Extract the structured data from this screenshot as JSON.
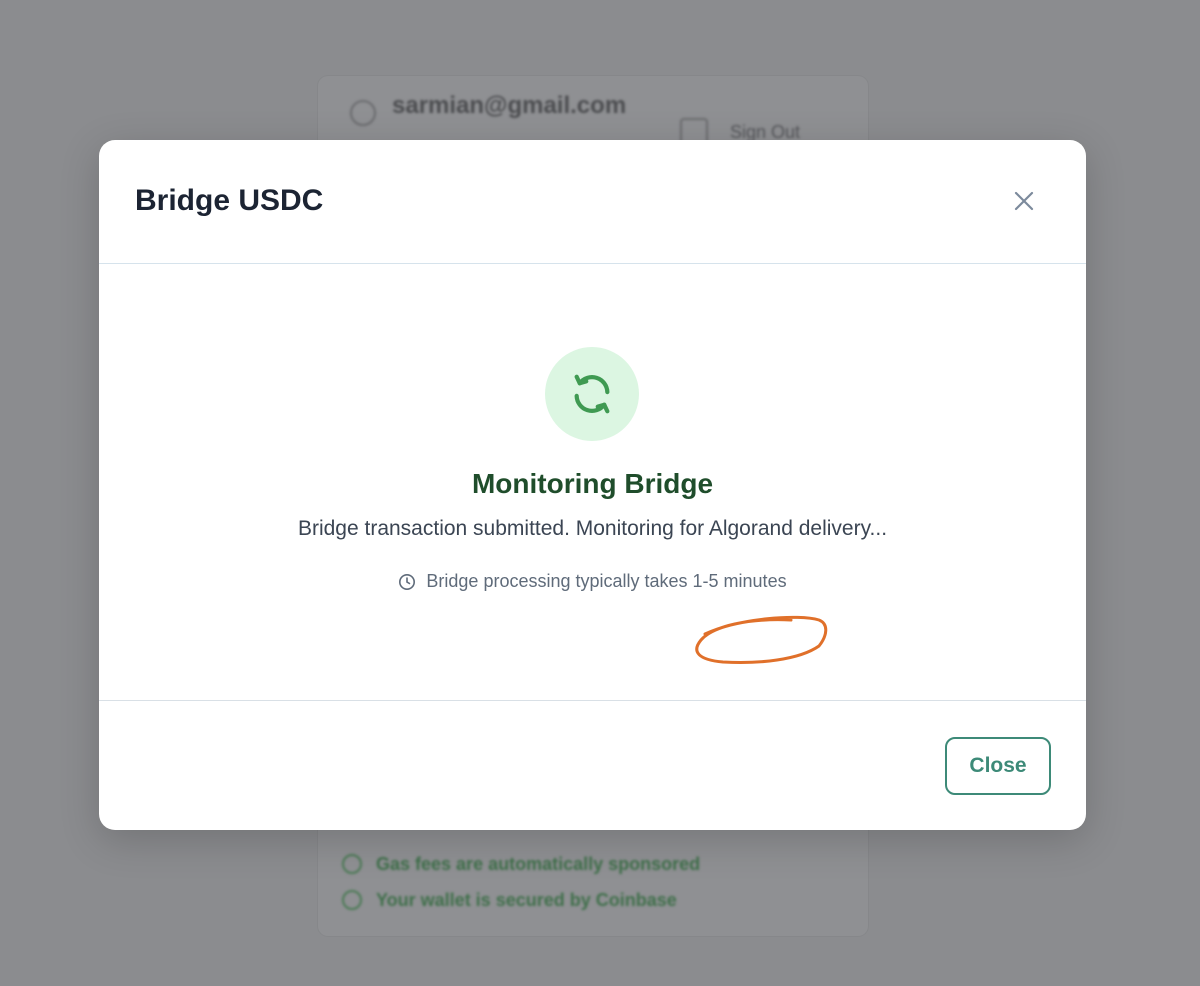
{
  "background": {
    "user_email": "sarmian@gmail.com",
    "signout_label": "Sign Out",
    "features": [
      "Gas fees are automatically sponsored",
      "Your wallet is secured by Coinbase"
    ]
  },
  "modal": {
    "title": "Bridge USDC",
    "close_icon": "close-icon",
    "status_icon": "refresh-icon",
    "status_title": "Monitoring Bridge",
    "status_message": "Bridge transaction submitted. Monitoring for Algorand delivery...",
    "note_icon": "clock-icon",
    "note_text": "Bridge processing typically takes 1-5 minutes",
    "close_button_label": "Close"
  },
  "colors": {
    "overlay": "#8b8c8f",
    "title": "#1c2433",
    "status_green": "#1f4d2b",
    "icon_green": "#3f9a52",
    "icon_bg": "#dcf6e2",
    "button_teal": "#3d8a78",
    "annotation_orange": "#e0702a"
  }
}
